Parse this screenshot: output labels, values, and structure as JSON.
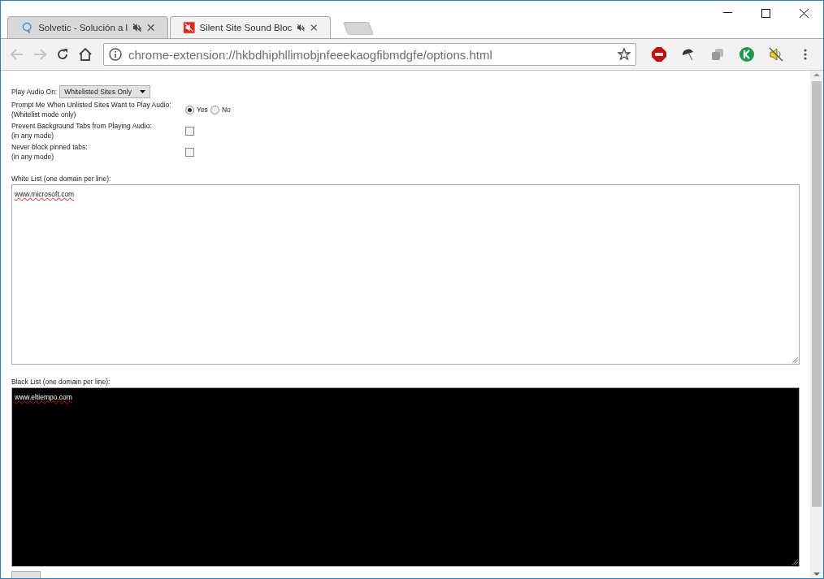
{
  "tabs": [
    {
      "title": "Solvetic - Solución a l",
      "selected": false,
      "kind": "site"
    },
    {
      "title": "Silent Site Sound Bloc",
      "selected": true,
      "kind": "extension"
    }
  ],
  "address_bar": {
    "url": "chrome-extension://hkbdhiphllimobjnfeeekaogfibmdgfe/options.html"
  },
  "options": {
    "play_audio": {
      "label": "Play Audio On:",
      "value": "Whitelisted Sites Only"
    },
    "prompt": {
      "label": "Prompt Me When Unlisted Sites Want to Play Audio:",
      "note": "(Whitelist mode only)",
      "choices": [
        {
          "label": "Yes",
          "selected": true
        },
        {
          "label": "No",
          "selected": false
        }
      ]
    },
    "checks": [
      {
        "label": "Prevent Background Tabs from Playing Audio:",
        "note": "(in any mode)",
        "checked": false
      },
      {
        "label": "Never block pinned tabs:",
        "note": "(in any mode)",
        "checked": false
      }
    ],
    "white_list": {
      "label": "White List (one domain per line):",
      "value": "www.microsoft.com"
    },
    "black_list": {
      "label": "Black List (one domain per line):",
      "value": "www.eltiempo.com"
    }
  }
}
